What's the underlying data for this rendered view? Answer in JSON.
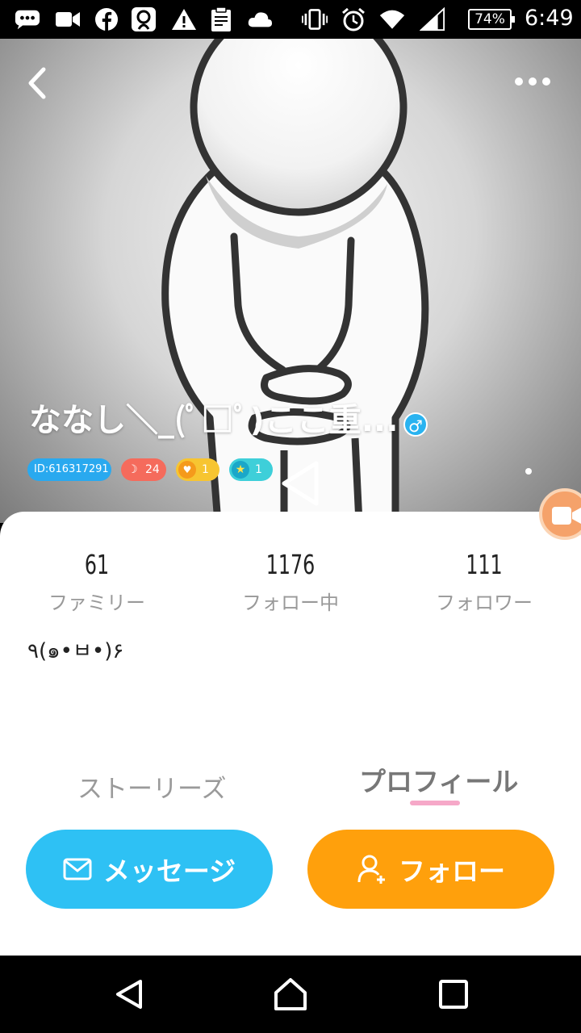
{
  "status_bar": {
    "icons": [
      "messages-icon",
      "video-icon",
      "facebook-icon",
      "app-icon",
      "warning-icon",
      "clipboard-icon",
      "cloud-icon",
      "vibrate-icon",
      "alarm-icon",
      "wifi-icon",
      "signal-icon"
    ],
    "battery": "74%",
    "time": "6:49"
  },
  "header": {
    "username": "ななし＼_(ﾟ□ﾟ)ここ重...",
    "gender_symbol": "♂",
    "badges": {
      "id": "ID:616317291",
      "moon_count": "24",
      "heart_count": "1",
      "star_count": "1"
    }
  },
  "stats": [
    {
      "value": "61",
      "label": "ファミリー"
    },
    {
      "value": "1176",
      "label": "フォロー中"
    },
    {
      "value": "111",
      "label": "フォロワー"
    }
  ],
  "bio": "٩(๑•ㅂ•)۶",
  "tabs": {
    "stories": "ストーリーズ",
    "profile": "プロフィール",
    "active": "profile"
  },
  "actions": {
    "message_label": "メッセージ",
    "follow_label": "フォロー"
  },
  "colors": {
    "message_button": "#2ec1f4",
    "follow_button": "#ffa00c",
    "tab_underline": "#f6a8c8",
    "id_badge": "#29a9ef"
  }
}
